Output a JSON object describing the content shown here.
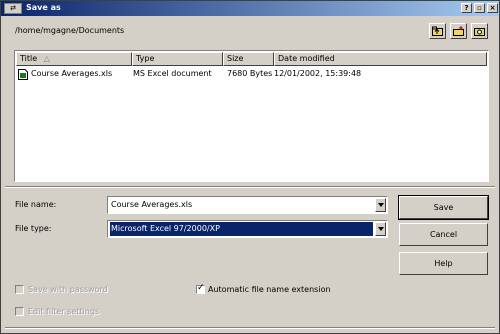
{
  "window": {
    "title": "Save as",
    "icon_text": "⇄"
  },
  "path": "/home/mgagne/Documents",
  "columns": [
    "Title",
    "Type",
    "Size",
    "Date modified"
  ],
  "sort_indicator": "△",
  "files": [
    {
      "title": "Course Averages.xls",
      "type": "MS Excel document",
      "size": "7680 Bytes",
      "date": "12/01/2002, 15:39:48"
    }
  ],
  "form": {
    "file_name_label": "File name:",
    "file_name_value": "Course Averages.xls",
    "file_type_label": "File type:",
    "file_type_value": "Microsoft Excel 97/2000/XP"
  },
  "buttons": {
    "save": "Save",
    "cancel": "Cancel",
    "help": "Help"
  },
  "options": {
    "save_with_password": "Save with password",
    "auto_extension": "Automatic file name extension",
    "edit_filter_settings": "Edit filter settings"
  },
  "colors": {
    "selection": "#0a246a",
    "titlebar": "#0a246a"
  }
}
